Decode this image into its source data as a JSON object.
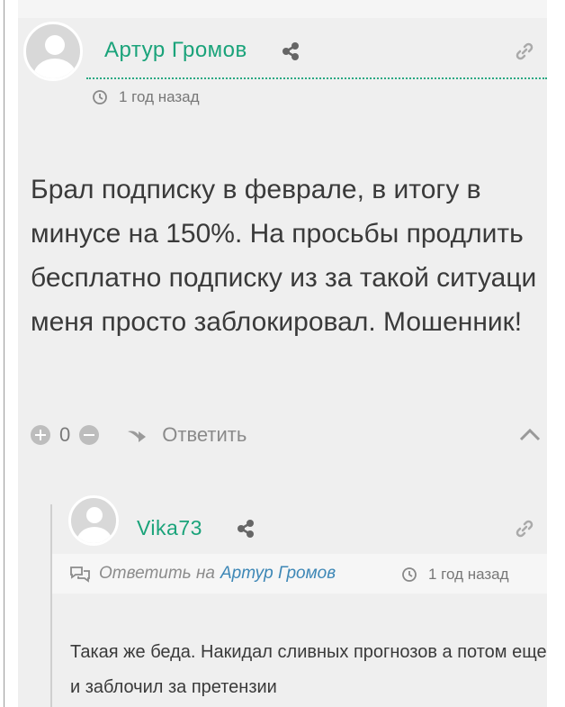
{
  "comment": {
    "author": "Артур Громов",
    "time": "1 год назад",
    "text": "Брал подписку в феврале, в итогу в минусе на 150%. На просьбы продлить бесплатно подписку из за такой ситуаци меня просто заблокировал. Мошенник!",
    "vote_count": "0",
    "reply_label": "Ответить"
  },
  "reply": {
    "author": "Vika73",
    "reply_to_label": "Ответить на",
    "reply_to_author": "Артур Громов",
    "time": "1 год назад",
    "text": "Такая же беда. Накидал сливных прогнозов а потом еще и заблочил за претензии"
  },
  "colors": {
    "author": "#1aa37a",
    "reply_target": "#3d87b6",
    "background": "#efefef"
  },
  "icons": [
    "avatar-placeholder",
    "share-icon",
    "link-icon",
    "clock-icon",
    "plus-icon",
    "minus-icon",
    "reply-arrow-icon",
    "chevron-up-icon",
    "speech-bubbles-icon"
  ]
}
